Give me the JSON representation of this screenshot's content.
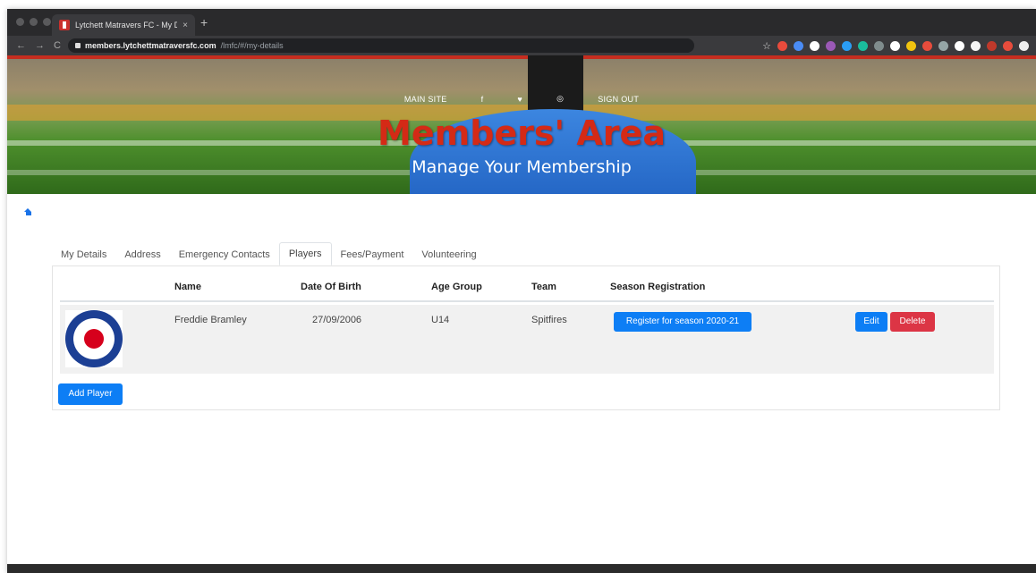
{
  "browser": {
    "tab_title": "Lytchett Matravers FC - My De",
    "tab_close": "×",
    "new_tab": "+",
    "url_host": "members.lytchettmatraversfc.com",
    "url_path": "/lmfc/#/my-details",
    "nav_back": "←",
    "nav_forward": "→",
    "nav_reload": "C",
    "star": "☆",
    "extension_colors": [
      "#e84b3c",
      "#4a8cf5",
      "#ffffff",
      "#9b59b6",
      "#2a9df4",
      "#1abc9c",
      "#7f8c8d",
      "#ffffff",
      "#f1c40f",
      "#e74c3c",
      "#95a5a6",
      "#ffffff",
      "#f5f5f5",
      "#c0392b",
      "#e74c3c",
      "#eeeeee"
    ]
  },
  "hero": {
    "nav": {
      "main_site": "MAIN SITE",
      "facebook": "f",
      "twitter": "♥",
      "instagram": "◎",
      "sign_out": "SIGN OUT"
    },
    "title": "Members' Area",
    "subtitle": "Manage Your Membership",
    "accent_color": "#d42a16"
  },
  "tabs": [
    {
      "label": "My Details",
      "active": false
    },
    {
      "label": "Address",
      "active": false
    },
    {
      "label": "Emergency Contacts",
      "active": false
    },
    {
      "label": "Players",
      "active": true
    },
    {
      "label": "Fees/Payment",
      "active": false
    },
    {
      "label": "Volunteering",
      "active": false
    }
  ],
  "table": {
    "headers": {
      "name": "Name",
      "dob": "Date Of Birth",
      "age_group": "Age Group",
      "team": "Team",
      "season_registration": "Season Registration"
    },
    "rows": [
      {
        "name": "Freddie Bramley",
        "dob": "27/09/2006",
        "age_group": "U14",
        "team": "Spitfires",
        "register_label": "Register for season 2020-21",
        "edit_label": "Edit",
        "delete_label": "Delete"
      }
    ]
  },
  "add_player_label": "Add Player"
}
